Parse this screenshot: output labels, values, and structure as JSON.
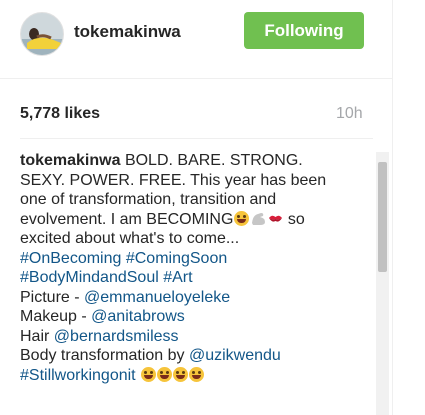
{
  "post": {
    "username": "tokemakinwa",
    "follow_button": "Following",
    "likes": "5,778 likes",
    "time": "10h"
  },
  "caption": {
    "user": "tokemakinwa",
    "l1": "BOLD. BARE. STRONG.",
    "l2": "SEXY. POWER. FREE. This year has been",
    "l3": "one of transformation, transition and",
    "l4a": "evolvement. I am BECOMING",
    "l4b": "so",
    "l5": "excited about what's to come...",
    "tag_onbecoming": "#OnBecoming",
    "tag_comingsoon": "#ComingSoon",
    "tag_bodymindsoul": "#BodyMindandSoul",
    "tag_art": "#Art",
    "picture_label": "Picture -",
    "picture_user": "@emmanueloyeleke",
    "makeup_label": "Makeup -",
    "makeup_user": "@anitabrows",
    "hair_label": "Hair",
    "hair_user": "@bernardsmiless",
    "body_label": "Body transformation by",
    "body_user": "@uzikwendu",
    "tag_stillworking": "#Stillworkingonit"
  },
  "icons": {
    "avatar": "profile-photo",
    "emoji_tongue": "face-with-tongue-emoji",
    "emoji_arm": "flexed-biceps-emoji",
    "emoji_lips": "kiss-mark-emoji",
    "emoji_laugh": "grinning-squinting-face-emoji"
  },
  "colors": {
    "follow_button_bg": "#70c050",
    "link": "#125688",
    "muted": "#a5a7aa",
    "text": "#262626"
  }
}
